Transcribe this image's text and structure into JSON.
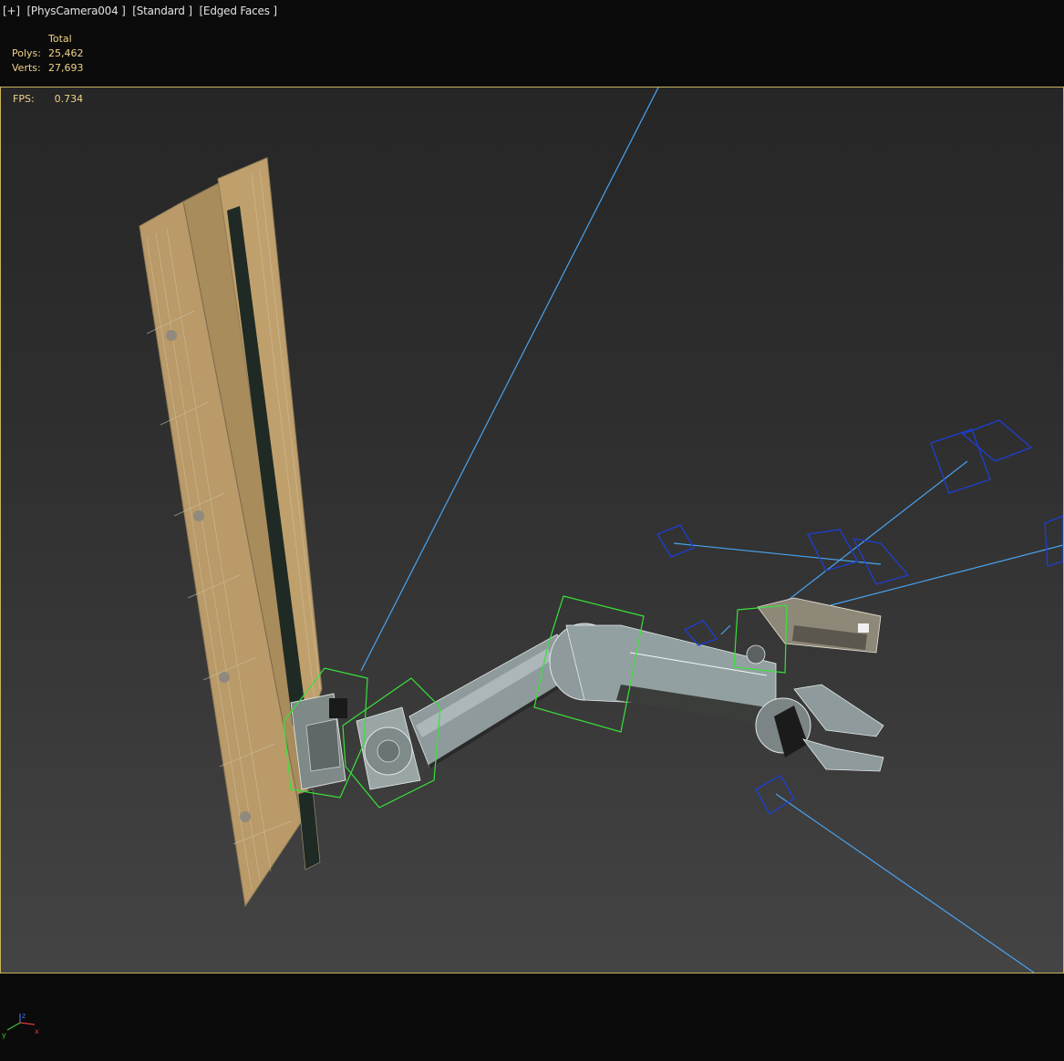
{
  "viewport": {
    "label_items": [
      "[+]",
      "[PhysCamera004 ]",
      "[Standard ]",
      "[Edged Faces ]"
    ],
    "fps_label": "FPS:",
    "fps_value": "0.734"
  },
  "stats": {
    "header": "Total",
    "polys_label": "Polys:",
    "polys_value": "25,462",
    "verts_label": "Verts:",
    "verts_value": "27,693"
  },
  "gizmo": {
    "axis_x": "x",
    "axis_y": "y",
    "axis_z": "z"
  },
  "colors": {
    "viewport_border": "#c8b45a",
    "stats_text": "#f0d38a",
    "selection_box": "#39e23a",
    "camera_helper": "#1d3fd0",
    "camera_line": "#4aa3f0",
    "wall_tan": "#b99a68",
    "arm_grey": "#8e9a9c"
  }
}
